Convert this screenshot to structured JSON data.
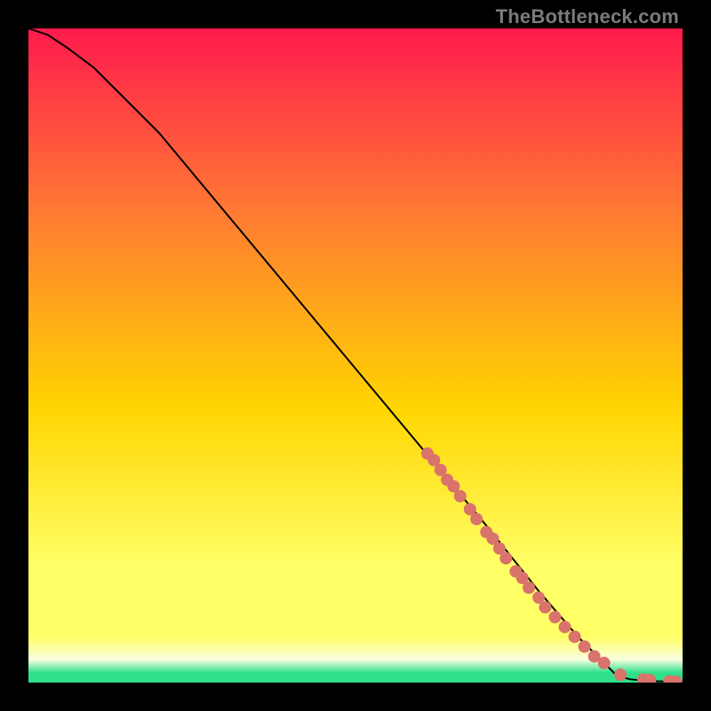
{
  "watermark": "TheBottleneck.com",
  "colors": {
    "top": "#ff1a4d",
    "mid_upper": "#ff7a33",
    "mid": "#ffd500",
    "mid_lower": "#ffff66",
    "pale": "#f8ffe0",
    "green": "#2fe08a",
    "curve": "#000000",
    "marker": "#d9736b"
  },
  "chart_data": {
    "type": "line",
    "title": "",
    "xlabel": "",
    "ylabel": "",
    "xlim": [
      0,
      100
    ],
    "ylim": [
      0,
      100
    ],
    "grid": false,
    "series": [
      {
        "name": "curve",
        "x": [
          0,
          3,
          6,
          10,
          15,
          20,
          30,
          40,
          50,
          60,
          70,
          78,
          84,
          88,
          90,
          92,
          94,
          96,
          98,
          100
        ],
        "y": [
          100,
          99,
          97,
          94,
          89,
          84,
          72,
          60,
          48,
          36,
          24,
          14,
          7,
          3,
          1,
          0.5,
          0.3,
          0.2,
          0.15,
          0.1
        ]
      }
    ],
    "markers": [
      {
        "x": 61,
        "y": 35
      },
      {
        "x": 62,
        "y": 34
      },
      {
        "x": 63,
        "y": 32.5
      },
      {
        "x": 64,
        "y": 31
      },
      {
        "x": 65,
        "y": 30
      },
      {
        "x": 66,
        "y": 28.5
      },
      {
        "x": 67.5,
        "y": 26.5
      },
      {
        "x": 68.5,
        "y": 25
      },
      {
        "x": 70,
        "y": 23
      },
      {
        "x": 71,
        "y": 22
      },
      {
        "x": 72,
        "y": 20.5
      },
      {
        "x": 73,
        "y": 19
      },
      {
        "x": 74.5,
        "y": 17
      },
      {
        "x": 75.5,
        "y": 16
      },
      {
        "x": 76.5,
        "y": 14.5
      },
      {
        "x": 78,
        "y": 13
      },
      {
        "x": 79,
        "y": 11.5
      },
      {
        "x": 80.5,
        "y": 10
      },
      {
        "x": 82,
        "y": 8.5
      },
      {
        "x": 83.5,
        "y": 7
      },
      {
        "x": 85,
        "y": 5.5
      },
      {
        "x": 86.5,
        "y": 4
      },
      {
        "x": 88,
        "y": 3
      },
      {
        "x": 90.5,
        "y": 1.2
      },
      {
        "x": 94,
        "y": 0.5
      },
      {
        "x": 95,
        "y": 0.4
      },
      {
        "x": 98,
        "y": 0.2
      },
      {
        "x": 99,
        "y": 0.15
      }
    ]
  }
}
